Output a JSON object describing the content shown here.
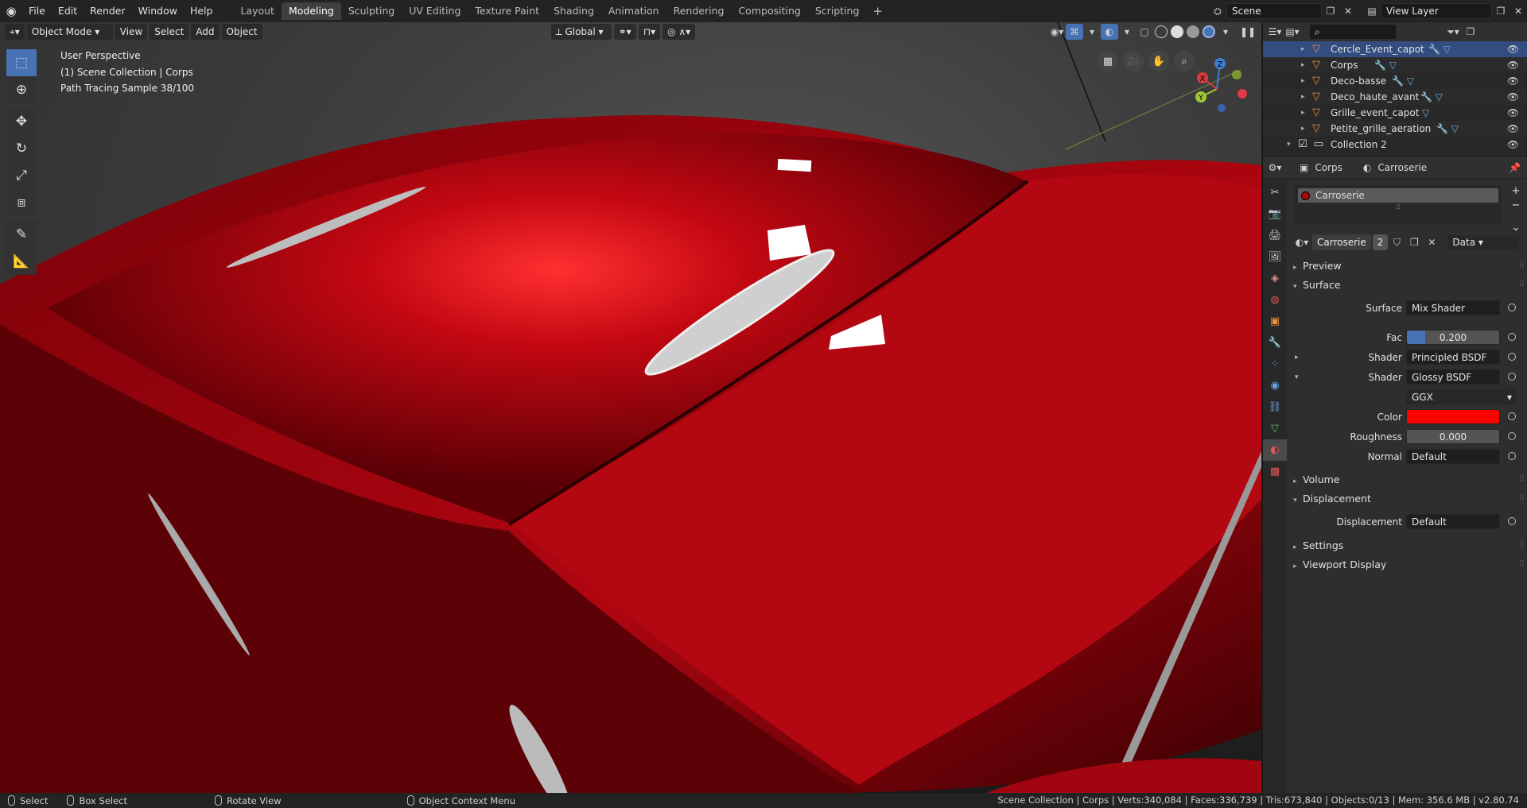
{
  "app": {
    "menus": [
      "File",
      "Edit",
      "Render",
      "Window",
      "Help"
    ],
    "workspaces": [
      "Layout",
      "Modeling",
      "Sculpting",
      "UV Editing",
      "Texture Paint",
      "Shading",
      "Animation",
      "Rendering",
      "Compositing",
      "Scripting"
    ],
    "active_workspace": "Modeling",
    "scene": "Scene",
    "view_layer": "View Layer"
  },
  "viewport": {
    "mode": "Object Mode",
    "menus": [
      "View",
      "Select",
      "Add",
      "Object"
    ],
    "orientation": "Global",
    "info": [
      "User Perspective",
      "(1) Scene Collection | Corps",
      "Path Tracing Sample 38/100"
    ],
    "gizmo": {
      "x": "X",
      "y": "Y",
      "z": "Z"
    },
    "body_color": "#c40812"
  },
  "outliner": {
    "search_placeholder": "",
    "rows": [
      {
        "name": "Cercle_Event_capot",
        "selected": true
      },
      {
        "name": "Corps",
        "selected": false
      },
      {
        "name": "Deco-basse",
        "selected": false
      },
      {
        "name": "Deco_haute_avant",
        "selected": false
      },
      {
        "name": "Grille_event_capot",
        "selected": false
      },
      {
        "name": "Petite_grille_aeration",
        "selected": false
      },
      {
        "name": "Collection 2",
        "selected": false
      }
    ]
  },
  "properties": {
    "breadcrumb_object": "Corps",
    "breadcrumb_material": "Carroserie",
    "slot_name": "Carroserie",
    "material_name": "Carroserie",
    "users": "2",
    "link": "Data",
    "panels": {
      "preview": "Preview",
      "surface": "Surface",
      "volume": "Volume",
      "displacement": "Displacement",
      "settings": "Settings",
      "viewport_display": "Viewport Display"
    },
    "surface": {
      "surface_label": "Surface",
      "surface_value": "Mix Shader",
      "fac_label": "Fac",
      "fac_value": "0.200",
      "fac_fraction": 0.2,
      "shader1_label": "Shader",
      "shader1_value": "Principled BSDF",
      "shader2_label": "Shader",
      "shader2_value": "Glossy BSDF",
      "distribution": "GGX",
      "color_label": "Color",
      "color_value": "#ff0000",
      "roughness_label": "Roughness",
      "roughness_value": "0.000",
      "normal_label": "Normal",
      "normal_value": "Default"
    },
    "displacement": {
      "label": "Displacement",
      "value": "Default"
    }
  },
  "statusbar": {
    "select": "Select",
    "box_select": "Box Select",
    "rotate_view": "Rotate View",
    "context_menu": "Object Context Menu",
    "stats": "Scene Collection | Corps | Verts:340,084 | Faces:336,739 | Tris:673,840 | Objects:0/13 | Mem: 356.6 MB | v2.80.74"
  }
}
